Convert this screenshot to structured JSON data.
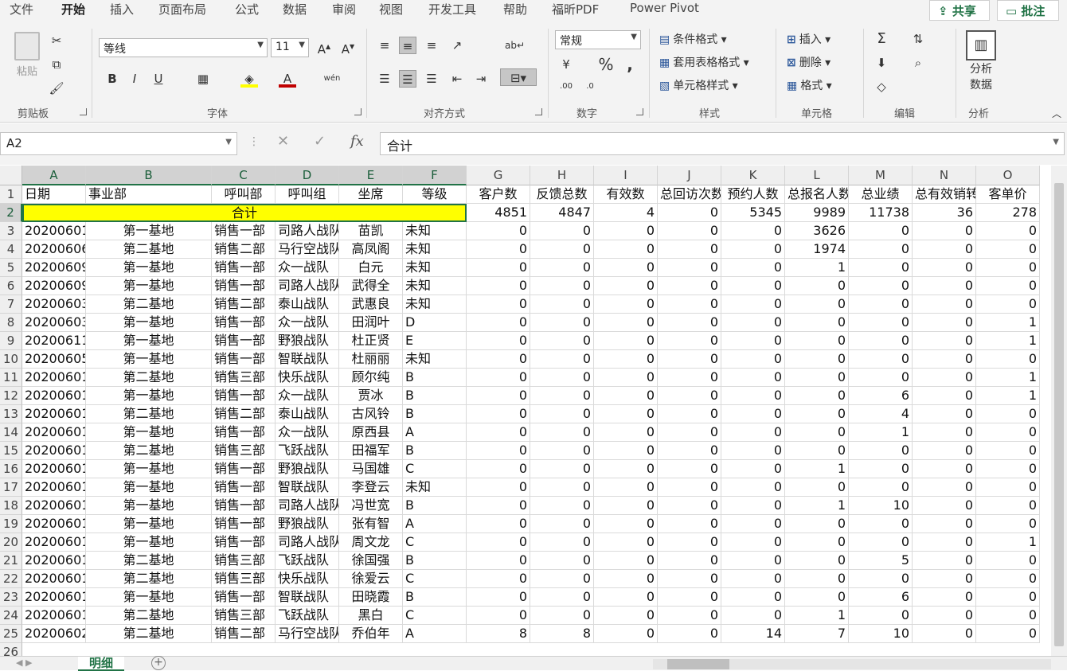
{
  "menu": {
    "tabs": [
      "文件",
      "开始",
      "插入",
      "页面布局",
      "公式",
      "数据",
      "审阅",
      "视图",
      "开发工具",
      "帮助",
      "福昕PDF",
      "Power Pivot"
    ],
    "active": "开始",
    "share": "共享",
    "comment": "批注"
  },
  "ribbon": {
    "clipboard": {
      "label": "剪贴板",
      "paste": "粘贴"
    },
    "font": {
      "label": "字体",
      "name": "等线",
      "size": "11",
      "pinyin": "wén"
    },
    "alignment": {
      "label": "对齐方式"
    },
    "number": {
      "label": "数字",
      "format": "常规"
    },
    "styles": {
      "label": "样式",
      "conditional": "条件格式",
      "table": "套用表格格式",
      "cell": "单元格样式"
    },
    "cells": {
      "label": "单元格",
      "insert": "插入",
      "delete": "删除",
      "format": "格式"
    },
    "editing": {
      "label": "编辑"
    },
    "analysis": {
      "label": "分析",
      "analyze_line1": "分析",
      "analyze_line2": "数据"
    }
  },
  "formula_bar": {
    "name_box": "A2",
    "content": "合计"
  },
  "columns": [
    "A",
    "B",
    "C",
    "D",
    "E",
    "F",
    "G",
    "H",
    "I",
    "J",
    "K",
    "L",
    "M",
    "N",
    "O"
  ],
  "header_row": [
    "日期",
    "事业部",
    "呼叫部",
    "呼叫组",
    "坐席",
    "等级",
    "客户数",
    "反馈总数",
    "有效数",
    "总回访次数",
    "预约人数",
    "总报名人数",
    "总业绩",
    "总有效销转",
    "客单价"
  ],
  "total_row": {
    "label": "合计",
    "values": [
      "4851",
      "4847",
      "4",
      "0",
      "5345",
      "9989",
      "11738",
      "36",
      "278"
    ]
  },
  "rows": [
    [
      "20200601",
      "第一基地",
      "销售一部",
      "司路人战队",
      "苗凯",
      "未知",
      "0",
      "0",
      "0",
      "0",
      "0",
      "3626",
      "0",
      "0",
      "0"
    ],
    [
      "20200606",
      "第二基地",
      "销售二部",
      "马行空战队",
      "高凤阁",
      "未知",
      "0",
      "0",
      "0",
      "0",
      "0",
      "1974",
      "0",
      "0",
      "0"
    ],
    [
      "20200609",
      "第一基地",
      "销售一部",
      "众一战队",
      "白元",
      "未知",
      "0",
      "0",
      "0",
      "0",
      "0",
      "1",
      "0",
      "0",
      "0"
    ],
    [
      "20200609",
      "第一基地",
      "销售一部",
      "司路人战队",
      "武得全",
      "未知",
      "0",
      "0",
      "0",
      "0",
      "0",
      "0",
      "0",
      "0",
      "0"
    ],
    [
      "20200603",
      "第二基地",
      "销售二部",
      "泰山战队",
      "武惠良",
      "未知",
      "0",
      "0",
      "0",
      "0",
      "0",
      "0",
      "0",
      "0",
      "0"
    ],
    [
      "20200603",
      "第一基地",
      "销售一部",
      "众一战队",
      "田润叶",
      "D",
      "0",
      "0",
      "0",
      "0",
      "0",
      "0",
      "0",
      "0",
      "1"
    ],
    [
      "20200611",
      "第一基地",
      "销售一部",
      "野狼战队",
      "杜正贤",
      "E",
      "0",
      "0",
      "0",
      "0",
      "0",
      "0",
      "0",
      "0",
      "1"
    ],
    [
      "20200605",
      "第一基地",
      "销售一部",
      "智联战队",
      "杜丽丽",
      "未知",
      "0",
      "0",
      "0",
      "0",
      "0",
      "0",
      "0",
      "0",
      "0"
    ],
    [
      "20200601",
      "第二基地",
      "销售三部",
      "快乐战队",
      "顾尔纯",
      "B",
      "0",
      "0",
      "0",
      "0",
      "0",
      "0",
      "0",
      "0",
      "1"
    ],
    [
      "20200601",
      "第一基地",
      "销售一部",
      "众一战队",
      "贾冰",
      "B",
      "0",
      "0",
      "0",
      "0",
      "0",
      "0",
      "6",
      "0",
      "1"
    ],
    [
      "20200601",
      "第二基地",
      "销售二部",
      "泰山战队",
      "古风铃",
      "B",
      "0",
      "0",
      "0",
      "0",
      "0",
      "0",
      "4",
      "0",
      "0"
    ],
    [
      "20200601",
      "第一基地",
      "销售一部",
      "众一战队",
      "原西县",
      "A",
      "0",
      "0",
      "0",
      "0",
      "0",
      "0",
      "1",
      "0",
      "0"
    ],
    [
      "20200601",
      "第二基地",
      "销售三部",
      "飞跃战队",
      "田福军",
      "B",
      "0",
      "0",
      "0",
      "0",
      "0",
      "0",
      "0",
      "0",
      "0"
    ],
    [
      "20200601",
      "第一基地",
      "销售一部",
      "野狼战队",
      "马国雄",
      "C",
      "0",
      "0",
      "0",
      "0",
      "0",
      "1",
      "0",
      "0",
      "0"
    ],
    [
      "20200601",
      "第一基地",
      "销售一部",
      "智联战队",
      "李登云",
      "未知",
      "0",
      "0",
      "0",
      "0",
      "0",
      "0",
      "0",
      "0",
      "0"
    ],
    [
      "20200601",
      "第一基地",
      "销售一部",
      "司路人战队",
      "冯世宽",
      "B",
      "0",
      "0",
      "0",
      "0",
      "0",
      "1",
      "10",
      "0",
      "0"
    ],
    [
      "20200601",
      "第一基地",
      "销售一部",
      "野狼战队",
      "张有智",
      "A",
      "0",
      "0",
      "0",
      "0",
      "0",
      "0",
      "0",
      "0",
      "0"
    ],
    [
      "20200601",
      "第一基地",
      "销售一部",
      "司路人战队",
      "周文龙",
      "C",
      "0",
      "0",
      "0",
      "0",
      "0",
      "0",
      "0",
      "0",
      "1"
    ],
    [
      "20200601",
      "第二基地",
      "销售三部",
      "飞跃战队",
      "徐国强",
      "B",
      "0",
      "0",
      "0",
      "0",
      "0",
      "0",
      "5",
      "0",
      "0"
    ],
    [
      "20200601",
      "第二基地",
      "销售三部",
      "快乐战队",
      "徐爱云",
      "C",
      "0",
      "0",
      "0",
      "0",
      "0",
      "0",
      "0",
      "0",
      "0"
    ],
    [
      "20200601",
      "第一基地",
      "销售一部",
      "智联战队",
      "田晓霞",
      "B",
      "0",
      "0",
      "0",
      "0",
      "0",
      "0",
      "6",
      "0",
      "0"
    ],
    [
      "20200601",
      "第二基地",
      "销售三部",
      "飞跃战队",
      "黑白",
      "C",
      "0",
      "0",
      "0",
      "0",
      "0",
      "1",
      "0",
      "0",
      "0"
    ],
    [
      "20200602",
      "第二基地",
      "销售二部",
      "马行空战队",
      "乔伯年",
      "A",
      "8",
      "8",
      "0",
      "0",
      "14",
      "7",
      "10",
      "0",
      "0"
    ]
  ],
  "sheet_tab": "明细"
}
